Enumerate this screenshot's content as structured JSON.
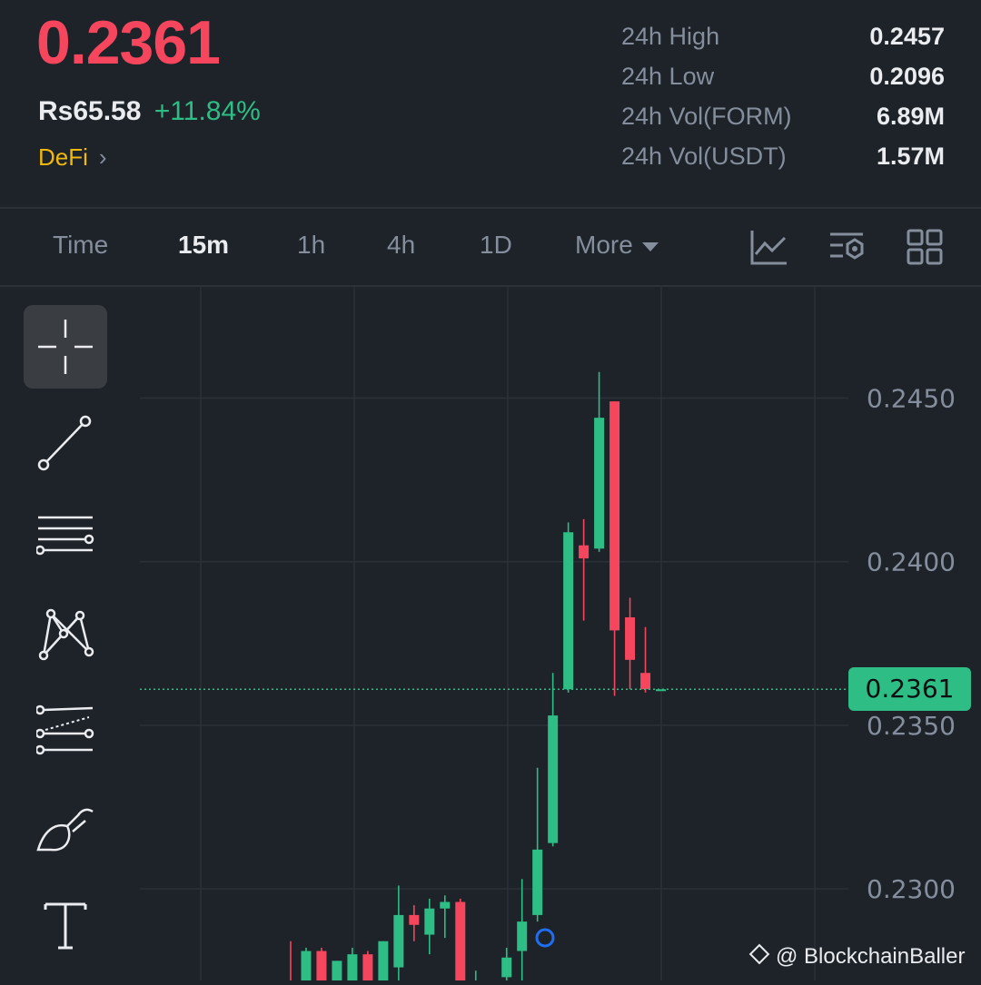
{
  "ticker": {
    "last_price": "0.2361",
    "fiat_price": "Rs65.58",
    "change_pct": "+11.84%",
    "category": "DeFi"
  },
  "stats": [
    {
      "label": "24h High",
      "value": "0.2457"
    },
    {
      "label": "24h Low",
      "value": "0.2096"
    },
    {
      "label": "24h Vol(FORM)",
      "value": "6.89M"
    },
    {
      "label": "24h Vol(USDT)",
      "value": "1.57M"
    }
  ],
  "tabs": [
    {
      "label": "Time",
      "active": false
    },
    {
      "label": "15m",
      "active": true
    },
    {
      "label": "1h",
      "active": false
    },
    {
      "label": "4h",
      "active": false
    },
    {
      "label": "1D",
      "active": false
    },
    {
      "label": "More",
      "active": false
    }
  ],
  "toolbar_icons": [
    "indicator-icon",
    "chart-settings-icon",
    "layout-grid-icon"
  ],
  "drawing_tools": [
    "crosshair-icon",
    "trend-line-icon",
    "horizontal-lines-icon",
    "pattern-icon",
    "fib-channel-icon",
    "brush-icon",
    "text-icon"
  ],
  "colors": {
    "up": "#2ebd85",
    "down": "#f6465d",
    "accent": "#f0b90b",
    "background": "#1e2329"
  },
  "chart_data": {
    "type": "candlestick",
    "y_ticks": [
      "0.2450",
      "0.2400",
      "0.2350",
      "0.2300"
    ],
    "ylim": [
      0.2272,
      0.2484
    ],
    "last_price_label": "0.2361",
    "candles": [
      {
        "o": 0.2265,
        "h": 0.2284,
        "l": 0.2262,
        "c": 0.2263
      },
      {
        "o": 0.2263,
        "h": 0.2282,
        "l": 0.226,
        "c": 0.2281
      },
      {
        "o": 0.2281,
        "h": 0.2282,
        "l": 0.2268,
        "c": 0.227
      },
      {
        "o": 0.227,
        "h": 0.2278,
        "l": 0.2264,
        "c": 0.2278
      },
      {
        "o": 0.2265,
        "h": 0.2282,
        "l": 0.226,
        "c": 0.228
      },
      {
        "o": 0.228,
        "h": 0.2281,
        "l": 0.2266,
        "c": 0.2268
      },
      {
        "o": 0.2268,
        "h": 0.2284,
        "l": 0.2262,
        "c": 0.2284
      },
      {
        "o": 0.2276,
        "h": 0.2301,
        "l": 0.2272,
        "c": 0.2292
      },
      {
        "o": 0.2292,
        "h": 0.2295,
        "l": 0.2284,
        "c": 0.2289
      },
      {
        "o": 0.2286,
        "h": 0.2297,
        "l": 0.228,
        "c": 0.2294
      },
      {
        "o": 0.2294,
        "h": 0.2298,
        "l": 0.2285,
        "c": 0.2296
      },
      {
        "o": 0.2296,
        "h": 0.2297,
        "l": 0.226,
        "c": 0.2262
      },
      {
        "o": 0.2262,
        "h": 0.2275,
        "l": 0.2258,
        "c": 0.2265
      },
      {
        "o": 0.2265,
        "h": 0.2268,
        "l": 0.2258,
        "c": 0.2262
      },
      {
        "o": 0.2273,
        "h": 0.2282,
        "l": 0.227,
        "c": 0.2279
      },
      {
        "o": 0.2281,
        "h": 0.2303,
        "l": 0.227,
        "c": 0.229
      },
      {
        "o": 0.2292,
        "h": 0.2337,
        "l": 0.229,
        "c": 0.2312
      },
      {
        "o": 0.2314,
        "h": 0.2366,
        "l": 0.2313,
        "c": 0.2353
      },
      {
        "o": 0.2361,
        "h": 0.2412,
        "l": 0.236,
        "c": 0.2409
      },
      {
        "o": 0.2405,
        "h": 0.2413,
        "l": 0.2382,
        "c": 0.2401
      },
      {
        "o": 0.2404,
        "h": 0.2458,
        "l": 0.2403,
        "c": 0.2444
      },
      {
        "o": 0.2449,
        "h": 0.2449,
        "l": 0.2359,
        "c": 0.2379
      },
      {
        "o": 0.2383,
        "h": 0.2389,
        "l": 0.2361,
        "c": 0.237
      },
      {
        "o": 0.2366,
        "h": 0.238,
        "l": 0.236,
        "c": 0.2361
      },
      {
        "o": 0.2361,
        "h": 0.2361,
        "l": 0.2361,
        "c": 0.2361
      }
    ]
  },
  "watermark": "@ BlockchainBaller"
}
